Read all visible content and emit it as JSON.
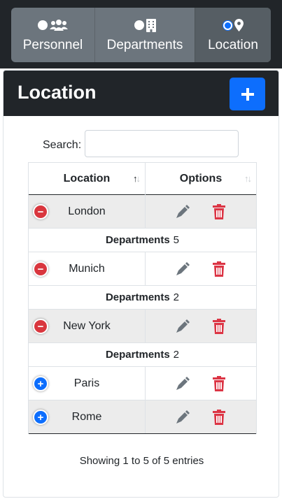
{
  "nav": {
    "tabs": [
      {
        "label": "Personnel",
        "icon": "users-icon",
        "selected": false
      },
      {
        "label": "Departments",
        "icon": "building-icon",
        "selected": false
      },
      {
        "label": "Location",
        "icon": "location-pin-icon",
        "selected": true
      }
    ]
  },
  "panel": {
    "title": "Location",
    "add_button_icon": "plus-icon"
  },
  "search": {
    "label": "Search:",
    "value": "",
    "placeholder": ""
  },
  "table": {
    "columns": [
      "Location",
      "Options"
    ],
    "sort_column": "Location",
    "rows": [
      {
        "location": "London",
        "expanded": true,
        "child_label": "Departments",
        "child_count": "5"
      },
      {
        "location": "Munich",
        "expanded": true,
        "child_label": "Departments",
        "child_count": "2"
      },
      {
        "location": "New York",
        "expanded": true,
        "child_label": "Departments",
        "child_count": "2"
      },
      {
        "location": "Paris",
        "expanded": false
      },
      {
        "location": "Rome",
        "expanded": false
      }
    ]
  },
  "footer": {
    "info": "Showing 1 to 5 of 5 entries"
  },
  "colors": {
    "dark": "#212529",
    "primary": "#0d6efd",
    "danger": "#dc3545",
    "edit_icon": "#6c757d"
  }
}
